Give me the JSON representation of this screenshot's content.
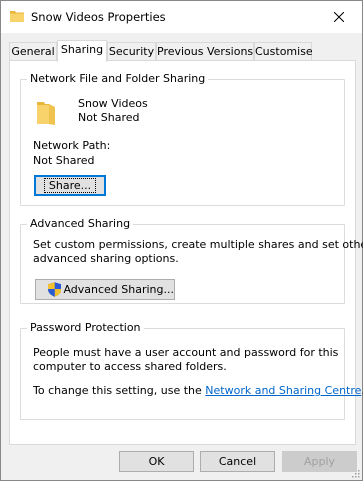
{
  "window": {
    "title": "Snow Videos Properties"
  },
  "tabs": [
    {
      "label": "General"
    },
    {
      "label": "Sharing"
    },
    {
      "label": "Security"
    },
    {
      "label": "Previous Versions"
    },
    {
      "label": "Customise"
    }
  ],
  "network_sharing": {
    "group_label": "Network File and Folder Sharing",
    "folder_name": "Snow Videos",
    "folder_status": "Not Shared",
    "path_label": "Network Path:",
    "path_value": "Not Shared",
    "share_button": "Share..."
  },
  "advanced_sharing": {
    "group_label": "Advanced Sharing",
    "description_line1": "Set custom permissions, create multiple shares and set other",
    "description_line2": "advanced sharing options.",
    "button": "Advanced Sharing..."
  },
  "password_protection": {
    "group_label": "Password Protection",
    "line1": "People must have a user account and password for this",
    "line2": "computer to access shared folders.",
    "change_prefix": "To change this setting, use the ",
    "link": "Network and Sharing Centre",
    "change_suffix": "."
  },
  "footer": {
    "ok": "OK",
    "cancel": "Cancel",
    "apply": "Apply"
  },
  "colors": {
    "link": "#0066cc",
    "folder": "#f5c542",
    "focus": "#0078d7"
  }
}
